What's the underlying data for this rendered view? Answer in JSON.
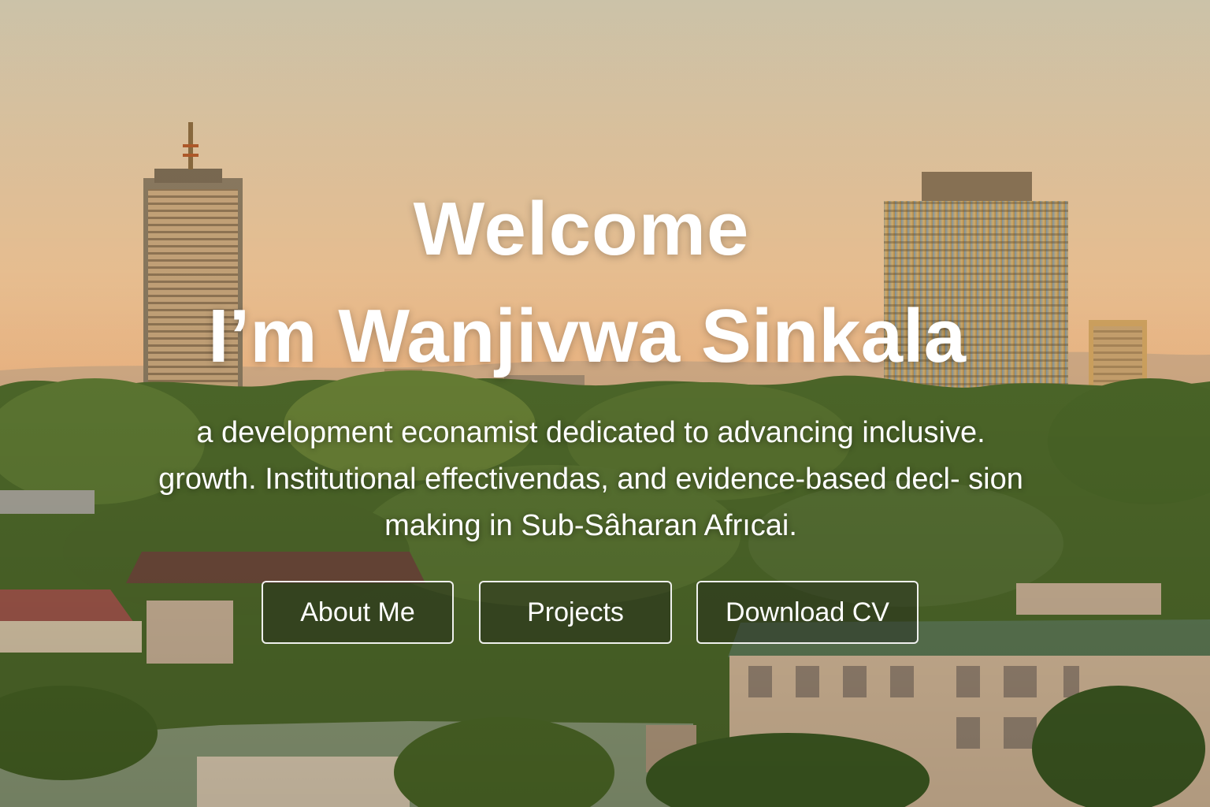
{
  "hero": {
    "welcome": "Welcome",
    "name": "I’m Wanjivwa Sinkala",
    "tagline": "a development econamist dedicated to advancing inclusive. growth. Institutional effectivendas, and evidence-based decl- sion making in Sub-Sâharan Afrıcai."
  },
  "buttons": {
    "about": "About Me",
    "projects": "Projects",
    "cv": "Download CV"
  },
  "colors": {
    "text": "#ffffff",
    "sky_top": "#cfc2a5",
    "sky_bottom": "#f3b77f",
    "foliage": "#4d6a2b"
  },
  "icons": []
}
